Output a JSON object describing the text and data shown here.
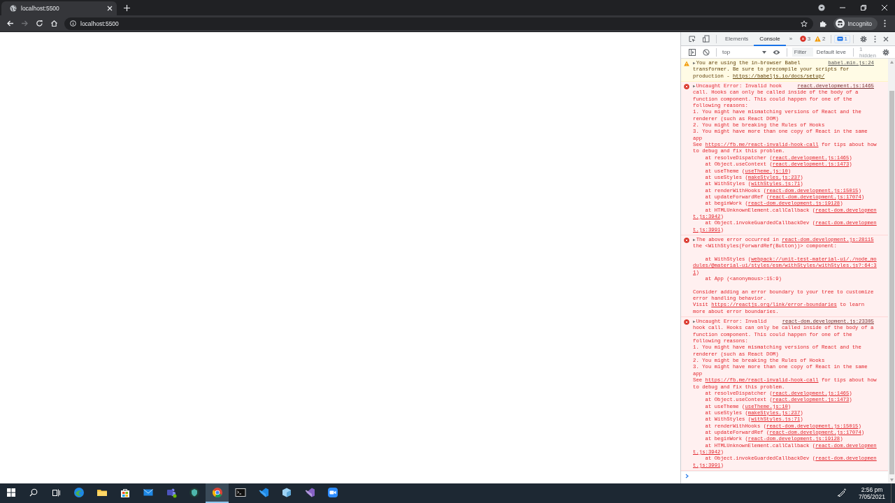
{
  "browser": {
    "tabs": [
      {
        "title": "localhost:5500",
        "selected": true
      }
    ],
    "address": "localhost:5500",
    "profile": "Incognito"
  },
  "devtools": {
    "tabs": [
      {
        "label": "Elements",
        "selected": false
      },
      {
        "label": "Console",
        "selected": true
      }
    ],
    "more": "»",
    "issue_counts": [
      {
        "kind": "error",
        "count": "3"
      },
      {
        "kind": "warning",
        "count": "2"
      },
      {
        "kind": "info",
        "count": "1"
      }
    ],
    "context": "top",
    "filter": {
      "placeholder": "Filter"
    },
    "levels": "Default leve",
    "hidden": "1 hidden",
    "console": {
      "messages": [
        {
          "kind": "warning",
          "toggle": "▶",
          "source": "babel.min.js:24",
          "blocks": [
            [
              [
                {
                  "kind": "text",
                  "text": "You are using the in-browser Babel"
                }
              ],
              [
                {
                  "kind": "text",
                  "text": "transformer. Be sure to precompile your scripts for"
                }
              ],
              [
                {
                  "kind": "text",
                  "text": "production - "
                },
                {
                  "kind": "link",
                  "text": "https://babeljs.io/docs/setup/"
                }
              ]
            ]
          ]
        },
        {
          "kind": "error",
          "toggle": "▶",
          "source": "react.development.js:1465",
          "blocks": [
            [
              [
                {
                  "kind": "text",
                  "text": "Uncaught Error: Invalid hook"
                }
              ],
              [
                {
                  "kind": "text",
                  "text": "call. Hooks can only be called inside of the body of a"
                }
              ],
              [
                {
                  "kind": "text",
                  "text": "function component. This could happen for one of the"
                }
              ],
              [
                {
                  "kind": "text",
                  "text": "following reasons:"
                }
              ],
              [
                {
                  "kind": "text",
                  "text": "1. You might have mismatching versions of React and the"
                }
              ],
              [
                {
                  "kind": "text",
                  "text": "renderer (such as React DOM)"
                }
              ],
              [
                {
                  "kind": "text",
                  "text": "2. You might be breaking the Rules of Hooks"
                }
              ],
              [
                {
                  "kind": "text",
                  "text": "3. You might have more than one copy of React in the same"
                }
              ],
              [
                {
                  "kind": "text",
                  "text": "app"
                }
              ],
              [
                {
                  "kind": "text",
                  "text": "See "
                },
                {
                  "kind": "link",
                  "text": "https://fb.me/react-invalid-hook-call"
                },
                {
                  "kind": "text",
                  "text": " for tips about how"
                }
              ],
              [
                {
                  "kind": "text",
                  "text": "to debug and fix this problem."
                }
              ],
              [
                {
                  "kind": "text",
                  "text": "    at resolveDispatcher ("
                },
                {
                  "kind": "link",
                  "text": "react.development.js:1465"
                },
                {
                  "kind": "text",
                  "text": ")"
                }
              ],
              [
                {
                  "kind": "text",
                  "text": "    at Object.useContext ("
                },
                {
                  "kind": "link",
                  "text": "react.development.js:1473"
                },
                {
                  "kind": "text",
                  "text": ")"
                }
              ],
              [
                {
                  "kind": "text",
                  "text": "    at useTheme ("
                },
                {
                  "kind": "link",
                  "text": "useTheme.js:10"
                },
                {
                  "kind": "text",
                  "text": ")"
                }
              ],
              [
                {
                  "kind": "text",
                  "text": "    at useStyles ("
                },
                {
                  "kind": "link",
                  "text": "makeStyles.js:237"
                },
                {
                  "kind": "text",
                  "text": ")"
                }
              ],
              [
                {
                  "kind": "text",
                  "text": "    at WithStyles ("
                },
                {
                  "kind": "link",
                  "text": "withStyles.js:71"
                },
                {
                  "kind": "text",
                  "text": ")"
                }
              ],
              [
                {
                  "kind": "text",
                  "text": "    at renderWithHooks ("
                },
                {
                  "kind": "link",
                  "text": "react-dom.development.js:15015"
                },
                {
                  "kind": "text",
                  "text": ")"
                }
              ],
              [
                {
                  "kind": "text",
                  "text": "    at updateForwardRef ("
                },
                {
                  "kind": "link",
                  "text": "react-dom.development.js:17074"
                },
                {
                  "kind": "text",
                  "text": ")"
                }
              ],
              [
                {
                  "kind": "text",
                  "text": "    at beginWork ("
                },
                {
                  "kind": "link",
                  "text": "react-dom.development.js:19128"
                },
                {
                  "kind": "text",
                  "text": ")"
                }
              ],
              [
                {
                  "kind": "text",
                  "text": "    at HTMLUnknownElement.callCallback ("
                },
                {
                  "kind": "link",
                  "text": "react-dom.developmen"
                }
              ],
              [
                {
                  "kind": "link",
                  "text": "t.js:3942"
                },
                {
                  "kind": "text",
                  "text": ")"
                }
              ],
              [
                {
                  "kind": "text",
                  "text": "    at Object.invokeGuardedCallbackDev ("
                },
                {
                  "kind": "link",
                  "text": "react-dom.developmen"
                }
              ],
              [
                {
                  "kind": "link",
                  "text": "t.js:3991"
                },
                {
                  "kind": "text",
                  "text": ")"
                }
              ]
            ]
          ]
        },
        {
          "kind": "error",
          "toggle": "▶",
          "blocks": [
            [
              [
                {
                  "kind": "text",
                  "text": "The above error occurred in "
                },
                {
                  "kind": "link",
                  "text": "react-dom.development.js:28115"
                }
              ],
              [
                {
                  "kind": "text",
                  "text": "the <WithStyles(ForwardRef(Button))> component:"
                }
              ]
            ],
            [
              [
                {
                  "kind": "text",
                  "text": "    at WithStyles ("
                },
                {
                  "kind": "link",
                  "text": "webpack://unit-test-material-ui/./node_mo"
                }
              ],
              [
                {
                  "kind": "link",
                  "text": "dules/@material-ui/styles/esm/withStyles/withStyles.js?:64:3"
                }
              ],
              [
                {
                  "kind": "link",
                  "text": "1"
                },
                {
                  "kind": "text",
                  "text": ")"
                }
              ],
              [
                {
                  "kind": "text",
                  "text": "    at App (<anonymous>:15:9)"
                }
              ]
            ],
            [
              [
                {
                  "kind": "text",
                  "text": "Consider adding an error boundary to your tree to customize"
                }
              ],
              [
                {
                  "kind": "text",
                  "text": "error handling behavior."
                }
              ],
              [
                {
                  "kind": "text",
                  "text": "Visit "
                },
                {
                  "kind": "link",
                  "text": "https://reactjs.org/link/error-boundaries"
                },
                {
                  "kind": "text",
                  "text": " to learn"
                }
              ],
              [
                {
                  "kind": "text",
                  "text": "more about error boundaries."
                }
              ]
            ]
          ]
        },
        {
          "kind": "error",
          "toggle": "▶",
          "source": "react-dom.development.js:23305",
          "blocks": [
            [
              [
                {
                  "kind": "text",
                  "text": "Uncaught Error: Invalid"
                }
              ],
              [
                {
                  "kind": "text",
                  "text": "hook call. Hooks can only be called inside of the body of a"
                }
              ],
              [
                {
                  "kind": "text",
                  "text": "function component. This could happen for one of the"
                }
              ],
              [
                {
                  "kind": "text",
                  "text": "following reasons:"
                }
              ],
              [
                {
                  "kind": "text",
                  "text": "1. You might have mismatching versions of React and the"
                }
              ],
              [
                {
                  "kind": "text",
                  "text": "renderer (such as React DOM)"
                }
              ],
              [
                {
                  "kind": "text",
                  "text": "2. You might be breaking the Rules of Hooks"
                }
              ],
              [
                {
                  "kind": "text",
                  "text": "3. You might have more than one copy of React in the same"
                }
              ],
              [
                {
                  "kind": "text",
                  "text": "app"
                }
              ],
              [
                {
                  "kind": "text",
                  "text": "See "
                },
                {
                  "kind": "link",
                  "text": "https://fb.me/react-invalid-hook-call"
                },
                {
                  "kind": "text",
                  "text": " for tips about how"
                }
              ],
              [
                {
                  "kind": "text",
                  "text": "to debug and fix this problem."
                }
              ],
              [
                {
                  "kind": "text",
                  "text": "    at resolveDispatcher ("
                },
                {
                  "kind": "link",
                  "text": "react.development.js:1465"
                },
                {
                  "kind": "text",
                  "text": ")"
                }
              ],
              [
                {
                  "kind": "text",
                  "text": "    at Object.useContext ("
                },
                {
                  "kind": "link",
                  "text": "react.development.js:1473"
                },
                {
                  "kind": "text",
                  "text": ")"
                }
              ],
              [
                {
                  "kind": "text",
                  "text": "    at useTheme ("
                },
                {
                  "kind": "link",
                  "text": "useTheme.js:10"
                },
                {
                  "kind": "text",
                  "text": ")"
                }
              ],
              [
                {
                  "kind": "text",
                  "text": "    at useStyles ("
                },
                {
                  "kind": "link",
                  "text": "makeStyles.js:237"
                },
                {
                  "kind": "text",
                  "text": ")"
                }
              ],
              [
                {
                  "kind": "text",
                  "text": "    at WithStyles ("
                },
                {
                  "kind": "link",
                  "text": "withStyles.js:71"
                },
                {
                  "kind": "text",
                  "text": ")"
                }
              ],
              [
                {
                  "kind": "text",
                  "text": "    at renderWithHooks ("
                },
                {
                  "kind": "link",
                  "text": "react-dom.development.js:15015"
                },
                {
                  "kind": "text",
                  "text": ")"
                }
              ],
              [
                {
                  "kind": "text",
                  "text": "    at updateForwardRef ("
                },
                {
                  "kind": "link",
                  "text": "react-dom.development.js:17074"
                },
                {
                  "kind": "text",
                  "text": ")"
                }
              ],
              [
                {
                  "kind": "text",
                  "text": "    at beginWork ("
                },
                {
                  "kind": "link",
                  "text": "react-dom.development.js:19128"
                },
                {
                  "kind": "text",
                  "text": ")"
                }
              ],
              [
                {
                  "kind": "text",
                  "text": "    at HTMLUnknownElement.callCallback ("
                },
                {
                  "kind": "link",
                  "text": "react-dom.developmen"
                }
              ],
              [
                {
                  "kind": "link",
                  "text": "t.js:3942"
                },
                {
                  "kind": "text",
                  "text": ")"
                }
              ],
              [
                {
                  "kind": "text",
                  "text": "    at Object.invokeGuardedCallbackDev ("
                },
                {
                  "kind": "link",
                  "text": "react-dom.developmen"
                }
              ],
              [
                {
                  "kind": "link",
                  "text": "t.js:3991"
                },
                {
                  "kind": "text",
                  "text": ")"
                }
              ]
            ]
          ]
        }
      ]
    }
  },
  "taskbar": {
    "apps": [
      {
        "selected": false
      },
      {
        "selected": false
      },
      {
        "selected": false
      },
      {
        "selected": false
      },
      {
        "selected": false
      },
      {
        "selected": false
      },
      {
        "selected": true
      },
      {
        "selected": false
      },
      {
        "selected": false
      },
      {
        "selected": false
      },
      {
        "selected": false
      },
      {
        "selected": false
      }
    ],
    "time": "2:56 pm",
    "date": "7/05/2021"
  }
}
